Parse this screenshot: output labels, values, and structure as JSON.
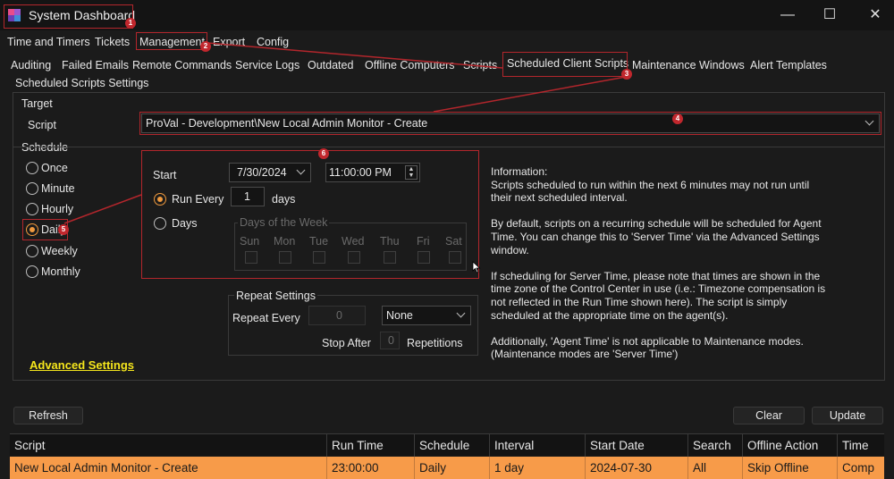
{
  "window": {
    "title": "System Dashboard",
    "minimize": "—",
    "maximize": "☐",
    "close": "✕"
  },
  "menu": [
    "Time and Timers",
    "Tickets",
    "Management",
    "Export",
    "Config"
  ],
  "subtabs": [
    "Auditing",
    "Failed Emails",
    "Remote Commands",
    "Service Logs",
    "Outdated",
    "Offline Computers",
    "Scripts",
    "Scheduled Client Scripts",
    "Maintenance Windows",
    "Alert Templates"
  ],
  "panel_title": "Scheduled Scripts Settings",
  "target": {
    "legend": "Target",
    "script_label": "Script",
    "script_value": "ProVal - Development\\New Local Admin Monitor - Create"
  },
  "schedule": {
    "legend": "Schedule",
    "options": [
      "Once",
      "Minute",
      "Hourly",
      "Daily",
      "Weekly",
      "Monthly"
    ],
    "selected": "Daily"
  },
  "daily": {
    "start_label": "Start",
    "start_date": "7/30/2024",
    "start_time": "11:00:00 PM",
    "run_every_label": "Run Every",
    "run_every_value": "1",
    "run_every_unit": "days",
    "days_label": "Days",
    "days_of_week_legend": "Days of the Week",
    "weekdays": [
      "Sun",
      "Mon",
      "Tue",
      "Wed",
      "Thu",
      "Fri",
      "Sat"
    ]
  },
  "repeat": {
    "legend": "Repeat Settings",
    "repeat_every_label": "Repeat Every",
    "repeat_every_value": "0",
    "unit_value": "None",
    "stop_after_label": "Stop After",
    "stop_after_value": "0",
    "repetitions_label": "Repetitions"
  },
  "information": [
    "Information:\nScripts scheduled to run within the next 6 minutes may not run until their next scheduled interval.",
    "By default, scripts on a recurring schedule will be scheduled for Agent Time. You can change this to 'Server Time' via the Advanced Settings window.",
    "If scheduling for Server Time, please note that times are shown in the time zone of the Control Center in use (i.e.: Timezone compensation is not reflected in the Run Time shown here). The script is simply scheduled at the appropriate time on the agent(s).",
    "Additionally, 'Agent Time' is not applicable to Maintenance modes. (Maintenance modes are 'Server Time')"
  ],
  "advanced_link": "Advanced Settings",
  "buttons": {
    "refresh": "Refresh",
    "clear": "Clear",
    "update": "Update"
  },
  "table": {
    "columns": [
      "Script",
      "Run Time",
      "Schedule",
      "Interval",
      "Start Date",
      "Search",
      "Offline Action",
      "Time"
    ],
    "rows": [
      [
        "New Local Admin Monitor - Create",
        "23:00:00",
        "Daily",
        "1 day",
        "2024-07-30",
        "All",
        "Skip Offline",
        "Comp"
      ]
    ]
  },
  "callouts": [
    "1",
    "2",
    "3",
    "4",
    "5",
    "6"
  ],
  "colors": {
    "accent": "#f79b49",
    "callout": "#c1272d",
    "link": "#f5e61c",
    "background": "#1b1b1b"
  }
}
